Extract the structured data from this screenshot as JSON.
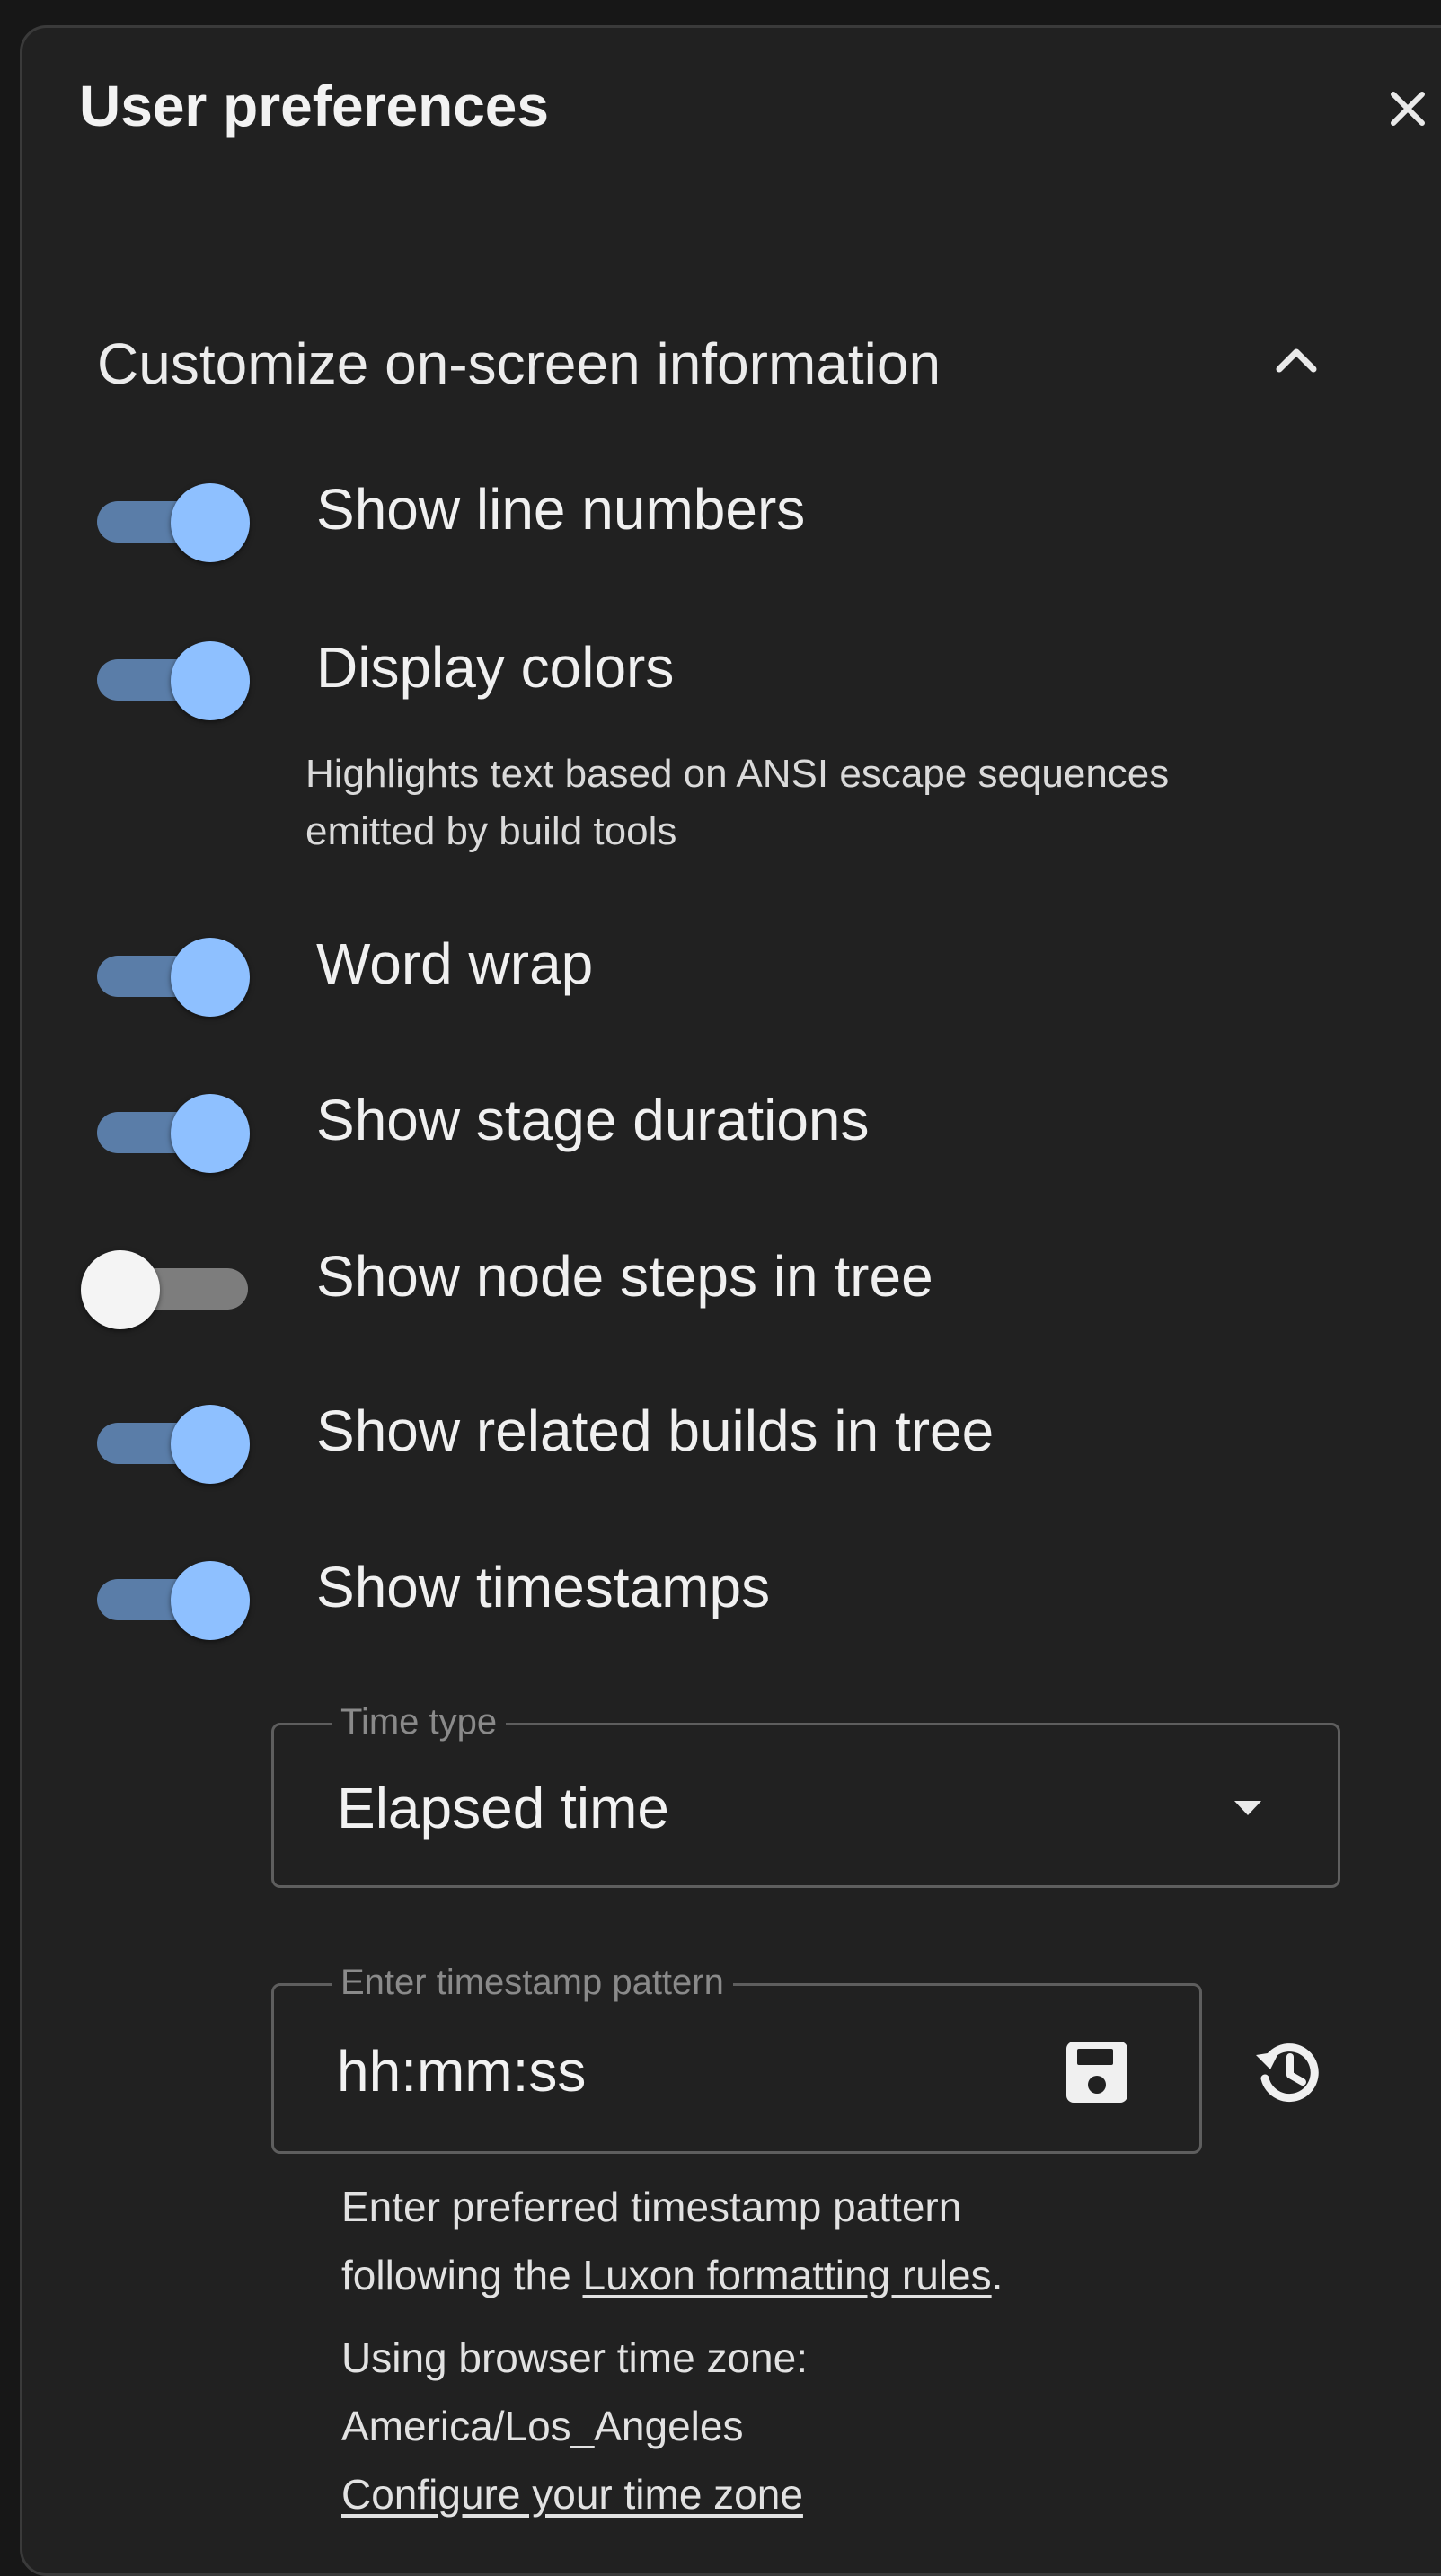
{
  "dialog": {
    "title": "User preferences",
    "close_icon": "close-icon"
  },
  "section": {
    "title": "Customize on-screen information",
    "expanded": true,
    "chevron_icon": "chevron-up-icon"
  },
  "toggles": [
    {
      "label": "Show line numbers",
      "checked": true
    },
    {
      "label": "Display colors",
      "checked": true,
      "helper": "Highlights text based on ANSI escape sequences emitted by build tools"
    },
    {
      "label": "Word wrap",
      "checked": true
    },
    {
      "label": "Show stage durations",
      "checked": true
    },
    {
      "label": "Show node steps in tree",
      "checked": false
    },
    {
      "label": "Show related builds in tree",
      "checked": true
    },
    {
      "label": "Show timestamps",
      "checked": true
    }
  ],
  "time_type": {
    "label": "Time type",
    "value": "Elapsed time",
    "icon": "dropdown-arrow-icon"
  },
  "timestamp_pattern": {
    "label": "Enter timestamp pattern",
    "value": "hh:mm:ss",
    "save_icon": "save-icon",
    "restore_icon": "restore-history-icon"
  },
  "help": {
    "pattern_line1": "Enter preferred timestamp pattern",
    "pattern_line2_prefix": "following the ",
    "luxon_link": "Luxon formatting rules",
    "pattern_line2_suffix": ".",
    "tz_line1": "Using browser time zone:",
    "tz_value": "America/Los_Angeles",
    "configure_link": "Configure your time zone"
  },
  "colors": {
    "background": "#171717",
    "panel": "#212121",
    "switch_on_track": "#5a7da8",
    "switch_on_thumb": "#8ec0ff",
    "switch_off_thumb": "#f4f4f4",
    "text": "#f0f0f0"
  }
}
